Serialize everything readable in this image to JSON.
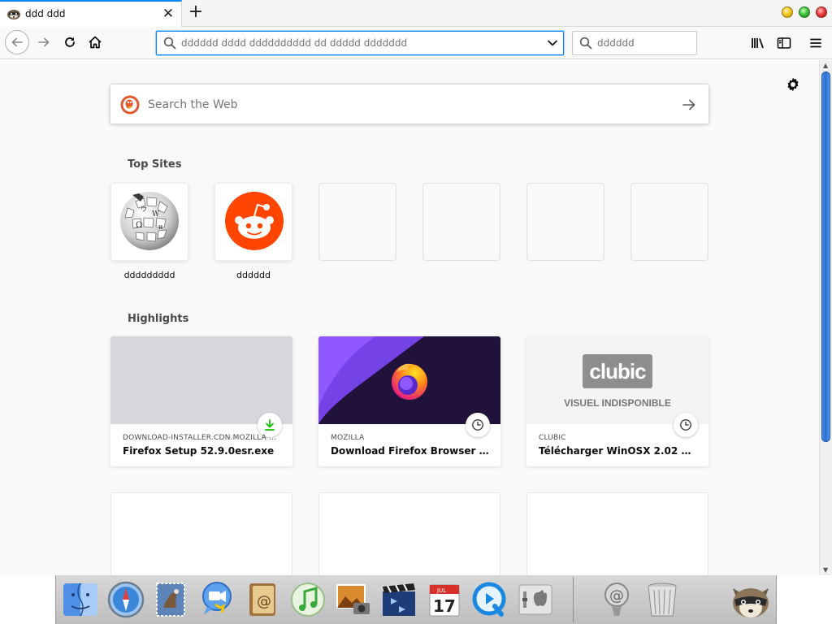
{
  "tab": {
    "title": "ddd ddd",
    "favicon": "raccoon-icon"
  },
  "toolbar": {
    "url_placeholder": "dddddd dddd dddddddddd dd ddddd ddddddd",
    "search_placeholder": "dddddd",
    "icons": [
      "back-icon",
      "forward-icon",
      "reload-icon",
      "home-icon",
      "library-icon",
      "sidebar-icon",
      "menu-icon"
    ]
  },
  "newtab": {
    "search_placeholder": "Search the Web",
    "top_sites_title": "Top Sites",
    "highlights_title": "Highlights",
    "top_sites": [
      {
        "label": "ddddddddd",
        "icon": "wikipedia-icon"
      },
      {
        "label": "dddddd",
        "icon": "reddit-icon"
      }
    ],
    "highlights": [
      {
        "source": "DOWNLOAD-INSTALLER.CDN.MOZILLA ...",
        "title": "Firefox Setup 52.9.0esr.exe",
        "badge": "download-icon"
      },
      {
        "source": "MOZILLA",
        "title": "Download Firefox Browser — Fa...",
        "badge": "clock-icon"
      },
      {
        "source": "CLUBIC",
        "title": "Télécharger WinOSX 2.02 gratui...",
        "badge": "clock-icon",
        "logo_text": "clubic",
        "placeholder_text": "VISUEL INDISPONIBLE"
      }
    ]
  },
  "dock": {
    "apps": [
      "finder-icon",
      "safari-icon",
      "mail-icon",
      "ichat-icon",
      "address-book-icon",
      "itunes-icon",
      "iphoto-icon",
      "imovie-icon",
      "ical-icon",
      "quicktime-icon",
      "system-preferences-icon",
      "mail-stamp-icon",
      "trash-icon"
    ],
    "calendar_month": "JUL",
    "calendar_day": "17"
  },
  "colors": {
    "accent": "#0a84ff",
    "reddit": "#ff4500",
    "firefox_bg": "#20123a"
  }
}
